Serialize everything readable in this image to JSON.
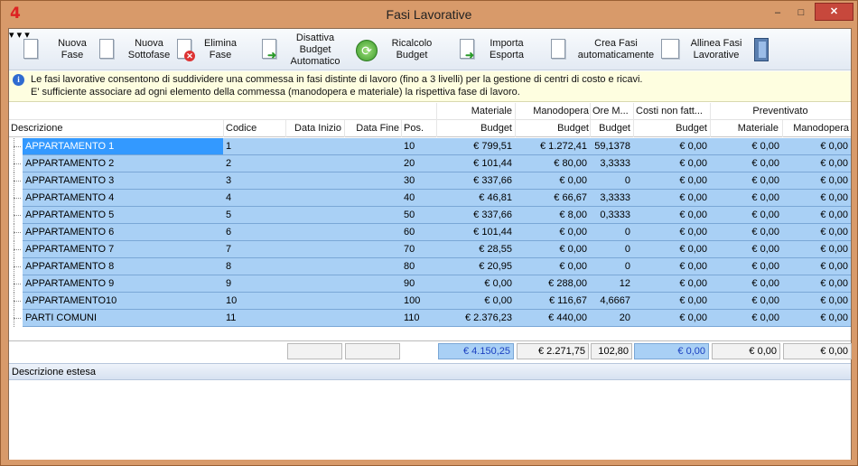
{
  "window": {
    "title": "Fasi Lavorative",
    "app_icon": "4",
    "min": "–",
    "max": "□",
    "close": "✕"
  },
  "toolbar": {
    "nuova_fase": "Nuova\nFase",
    "nuova_sottofase": "Nuova\nSottofase",
    "elimina_fase": "Elimina\nFase",
    "disattiva_budget": "Disattiva\nBudget\nAutomatico",
    "ricalcolo_budget": "Ricalcolo\nBudget",
    "esporta": "Importa\nEsporta",
    "crea_fasi": "Crea Fasi\nautomaticamente",
    "allinea_fasi": "Allinea Fasi\nLavorative",
    "dropdown": "▾"
  },
  "info": {
    "line1": "Le fasi lavorative consentono di suddividere una commessa in fasi distinte di lavoro (fino a 3 livelli) per la gestione di centri di costo e ricavi.",
    "line2": "E' sufficiente associare ad ogni elemento della commessa (manodopera e materiale) la rispettiva fase di lavoro.",
    "icon": "i"
  },
  "grid": {
    "group_headers": {
      "materiale": "Materiale",
      "manodopera": "Manodopera",
      "ore": "Ore M...",
      "costi_non_fatt": "Costi non fatt...",
      "preventivato": "Preventivato"
    },
    "columns": {
      "descrizione": "Descrizione",
      "codice": "Codice",
      "data_inizio": "Data Inizio",
      "data_fine": "Data Fine",
      "pos": "Pos.",
      "budget_mat": "Budget",
      "budget_man": "Budget",
      "budget_ore": "Budget",
      "budget_costi": "Budget",
      "prev_mat": "Materiale",
      "prev_man": "Manodopera"
    },
    "rows": [
      {
        "desc": "APPARTAMENTO 1",
        "code": "1",
        "pos": "10",
        "mat": "€ 799,51",
        "man": "€ 1.272,41",
        "ore": "59,1378",
        "costi": "€ 0,00",
        "pmat": "€ 0,00",
        "pman": "€ 0,00"
      },
      {
        "desc": "APPARTAMENTO 2",
        "code": "2",
        "pos": "20",
        "mat": "€ 101,44",
        "man": "€ 80,00",
        "ore": "3,3333",
        "costi": "€ 0,00",
        "pmat": "€ 0,00",
        "pman": "€ 0,00"
      },
      {
        "desc": "APPARTAMENTO 3",
        "code": "3",
        "pos": "30",
        "mat": "€ 337,66",
        "man": "€ 0,00",
        "ore": "0",
        "costi": "€ 0,00",
        "pmat": "€ 0,00",
        "pman": "€ 0,00"
      },
      {
        "desc": "APPARTAMENTO 4",
        "code": "4",
        "pos": "40",
        "mat": "€ 46,81",
        "man": "€ 66,67",
        "ore": "3,3333",
        "costi": "€ 0,00",
        "pmat": "€ 0,00",
        "pman": "€ 0,00"
      },
      {
        "desc": "APPARTAMENTO 5",
        "code": "5",
        "pos": "50",
        "mat": "€ 337,66",
        "man": "€ 8,00",
        "ore": "0,3333",
        "costi": "€ 0,00",
        "pmat": "€ 0,00",
        "pman": "€ 0,00"
      },
      {
        "desc": "APPARTAMENTO 6",
        "code": "6",
        "pos": "60",
        "mat": "€ 101,44",
        "man": "€ 0,00",
        "ore": "0",
        "costi": "€ 0,00",
        "pmat": "€ 0,00",
        "pman": "€ 0,00"
      },
      {
        "desc": "APPARTAMENTO 7",
        "code": "7",
        "pos": "70",
        "mat": "€ 28,55",
        "man": "€ 0,00",
        "ore": "0",
        "costi": "€ 0,00",
        "pmat": "€ 0,00",
        "pman": "€ 0,00"
      },
      {
        "desc": "APPARTAMENTO 8",
        "code": "8",
        "pos": "80",
        "mat": "€ 20,95",
        "man": "€ 0,00",
        "ore": "0",
        "costi": "€ 0,00",
        "pmat": "€ 0,00",
        "pman": "€ 0,00"
      },
      {
        "desc": "APPARTAMENTO 9",
        "code": "9",
        "pos": "90",
        "mat": "€ 0,00",
        "man": "€ 288,00",
        "ore": "12",
        "costi": "€ 0,00",
        "pmat": "€ 0,00",
        "pman": "€ 0,00"
      },
      {
        "desc": "APPARTAMENTO10",
        "code": "10",
        "pos": "100",
        "mat": "€ 0,00",
        "man": "€ 116,67",
        "ore": "4,6667",
        "costi": "€ 0,00",
        "pmat": "€ 0,00",
        "pman": "€ 0,00"
      },
      {
        "desc": "PARTI COMUNI",
        "code": "11",
        "pos": "110",
        "mat": "€ 2.376,23",
        "man": "€ 440,00",
        "ore": "20",
        "costi": "€ 0,00",
        "pmat": "€ 0,00",
        "pman": "€ 0,00"
      }
    ]
  },
  "totals": {
    "mat": "€ 4.150,25",
    "man": "€ 2.271,75",
    "ore": "102,80",
    "costi": "€ 0,00",
    "pmat": "€ 0,00",
    "pman": "€ 0,00"
  },
  "description_panel": {
    "label": "Descrizione estesa"
  },
  "colors": {
    "row_bg": "#a9d0f5",
    "selected_bg": "#3399ff",
    "window_frame": "#d89a6a",
    "close_button": "#c7483c"
  }
}
